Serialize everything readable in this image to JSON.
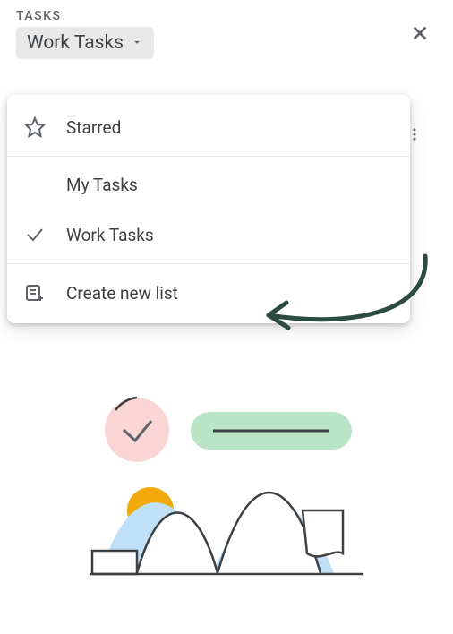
{
  "header": {
    "app_label": "TASKS",
    "current_list": "Work Tasks"
  },
  "dropdown": {
    "starred_label": "Starred",
    "lists": [
      {
        "label": "My Tasks",
        "selected": false
      },
      {
        "label": "Work Tasks",
        "selected": true
      }
    ],
    "create_label": "Create new list"
  },
  "icons": {
    "close": "close",
    "chevron_down": "chevron-down",
    "star": "star",
    "check": "check",
    "create_list": "list-plus",
    "overflow": "more-vert"
  }
}
